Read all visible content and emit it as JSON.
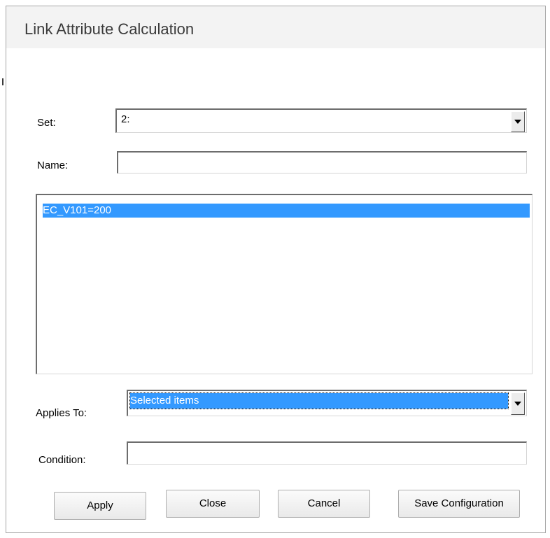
{
  "dialog": {
    "title": "Link Attribute Calculation"
  },
  "form": {
    "set_label": "Set:",
    "set_value": "2:",
    "name_label": "Name:",
    "name_value": "",
    "list_items": [
      "EC_V101=200"
    ],
    "applies_to_label": "Applies To:",
    "applies_to_value": "Selected items",
    "condition_label": "Condition:",
    "condition_value": ""
  },
  "buttons": {
    "apply": "Apply",
    "close": "Close",
    "cancel": "Cancel",
    "save_configuration": "Save Configuration"
  },
  "colors": {
    "selection": "#3399ff",
    "title_text": "#3a3a3a"
  }
}
